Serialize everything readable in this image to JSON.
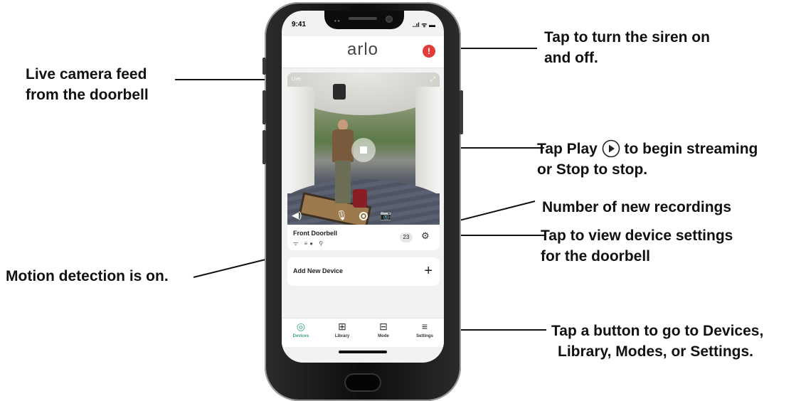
{
  "callouts": {
    "siren": [
      "Tap to turn the siren on",
      "and off."
    ],
    "live_feed": [
      "Live camera feed",
      "from the doorbell"
    ],
    "play_stop": {
      "prefix": "Tap Play",
      "suffix": "to begin streaming",
      "line2": "or Stop to stop.",
      "icon": "play-icon"
    },
    "recordings": [
      "Number of new recordings"
    ],
    "settings": [
      "Tap to view device settings",
      "for the doorbell"
    ],
    "motion": [
      "Motion detection is on."
    ],
    "tabs": [
      "Tap a button to go to Devices,",
      "Library, Modes, or Settings."
    ]
  },
  "phone": {
    "status": {
      "time": "9:41",
      "icons": "..ıl ᯤ ▬"
    },
    "app": {
      "logo": "arlo",
      "siren_icon": "!"
    },
    "feed": {
      "live_label": "Live",
      "expand_icon": "⤢"
    },
    "device": {
      "name": "Front Doorbell",
      "status_icons": "ᯤ ≡● ⚲",
      "new_recordings": "23",
      "settings_icon": "⚙"
    },
    "add_device": {
      "label": "Add New Device",
      "plus": "+"
    },
    "tabs": [
      {
        "label": "Devices",
        "icon": "◎",
        "active": true
      },
      {
        "label": "Library",
        "icon": "⊞",
        "active": false
      },
      {
        "label": "Mode",
        "icon": "⊟",
        "active": false
      },
      {
        "label": "Settings",
        "icon": "≡",
        "active": false
      }
    ]
  },
  "colors": {
    "accent": "#3aa17e",
    "siren": "#e23b3b"
  }
}
